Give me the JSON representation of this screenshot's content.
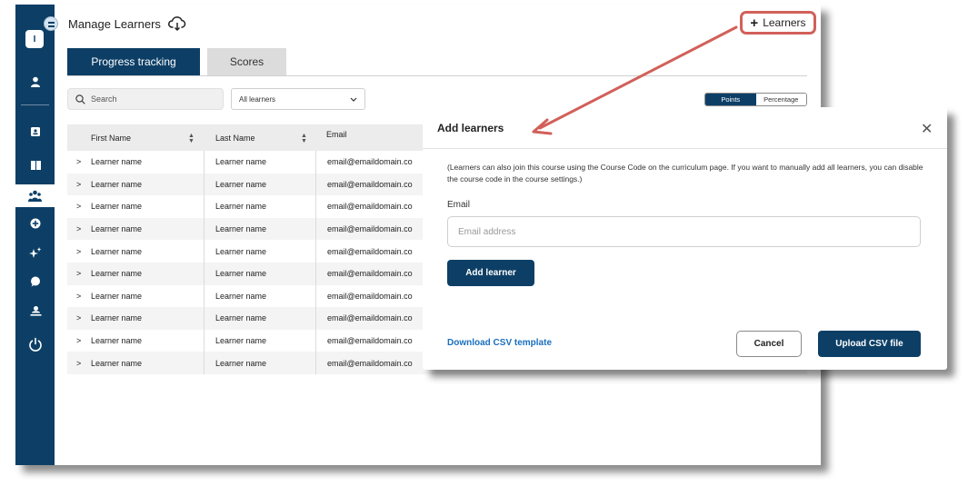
{
  "header": {
    "title": "Manage Learners",
    "add_learners_label": "Learners"
  },
  "sidebar": {
    "logo_letter": "I",
    "icons": [
      "user-icon",
      "id-card-icon",
      "book-icon",
      "users-icon",
      "plus-circle-icon",
      "sparkle-icon",
      "chat-icon",
      "cloud-person-icon",
      "power-icon"
    ]
  },
  "tabs": [
    {
      "label": "Progress tracking",
      "active": true
    },
    {
      "label": "Scores",
      "active": false
    }
  ],
  "search": {
    "placeholder": "Search"
  },
  "filter": {
    "value": "All learners"
  },
  "toggle": {
    "options": [
      "Points",
      "Percentage"
    ],
    "selected": "Points"
  },
  "table": {
    "columns": [
      "First Name",
      "Last Name",
      "Email"
    ],
    "rows": [
      {
        "first": "Learner name",
        "last": "Learner name",
        "email": "email@emaildomain.co"
      },
      {
        "first": "Learner name",
        "last": "Learner name",
        "email": "email@emaildomain.co"
      },
      {
        "first": "Learner name",
        "last": "Learner name",
        "email": "email@emaildomain.co"
      },
      {
        "first": "Learner name",
        "last": "Learner name",
        "email": "email@emaildomain.co"
      },
      {
        "first": "Learner name",
        "last": "Learner name",
        "email": "email@emaildomain.co"
      },
      {
        "first": "Learner name",
        "last": "Learner name",
        "email": "email@emaildomain.co"
      },
      {
        "first": "Learner name",
        "last": "Learner name",
        "email": "email@emaildomain.co"
      },
      {
        "first": "Learner name",
        "last": "Learner name",
        "email": "email@emaildomain.co"
      },
      {
        "first": "Learner name",
        "last": "Learner name",
        "email": "email@emaildomain.co"
      },
      {
        "first": "Learner name",
        "last": "Learner name",
        "email": "email@emaildomain.co"
      }
    ]
  },
  "modal": {
    "title": "Add learners",
    "note": "(Learners can also join this course using the Course Code on the curriculum page. If you want to manually add all learners, you can disable the course code in the course settings.)",
    "email_label": "Email",
    "email_placeholder": "Email address",
    "add_button": "Add learner",
    "csv_link": "Download CSV template",
    "cancel_button": "Cancel",
    "upload_button": "Upload CSV file"
  },
  "colors": {
    "primary": "#0d3f66",
    "highlight": "#d2605a",
    "link": "#1a6fbe"
  }
}
